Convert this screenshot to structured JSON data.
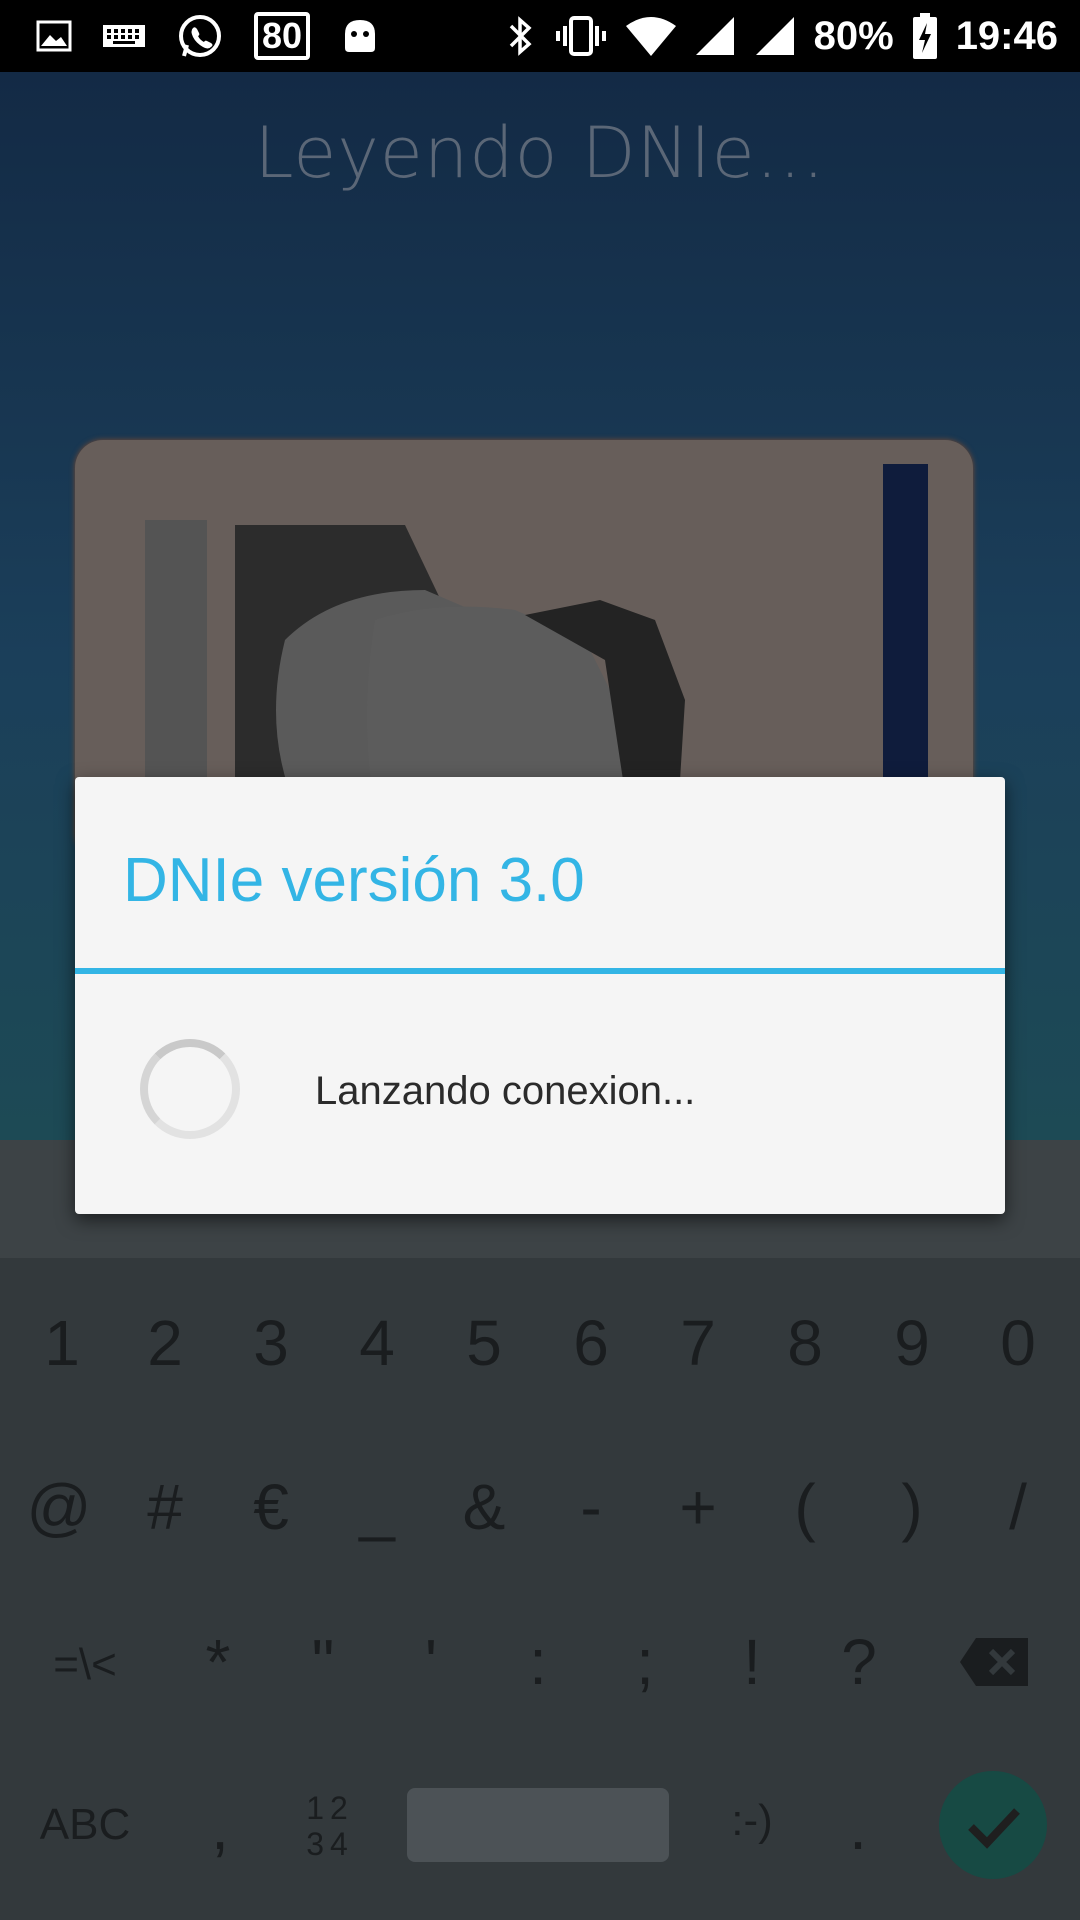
{
  "status_bar": {
    "notification_count": "80",
    "battery": "80%",
    "time": "19:46",
    "icons_left": [
      "image-icon",
      "keyboard-icon",
      "whatsapp-icon",
      "speed-limit-badge",
      "android-icon"
    ],
    "icons_right": [
      "bluetooth-icon",
      "vibrate-icon",
      "wifi-icon",
      "signal-icon",
      "signal-icon-2",
      "battery-charging-icon"
    ]
  },
  "app": {
    "title": "Leyendo DNIe..."
  },
  "dialog": {
    "title": "DNIe versión 3.0",
    "message": "Lanzando conexion...",
    "accent_color": "#33b5e5"
  },
  "keyboard": {
    "row1": [
      "1",
      "2",
      "3",
      "4",
      "5",
      "6",
      "7",
      "8",
      "9",
      "0"
    ],
    "row2": [
      "@",
      "#",
      "€",
      "_",
      "&",
      "-",
      "+",
      "(",
      ")",
      "/"
    ],
    "row3": [
      "=\\<",
      "*",
      "\"",
      "'",
      ":",
      ";",
      "!",
      "?"
    ],
    "row4": {
      "abc": "ABC",
      "comma": ",",
      "numpad_top": "12",
      "numpad_bottom": "34",
      "emoticon": ":-)",
      "period": "."
    }
  }
}
